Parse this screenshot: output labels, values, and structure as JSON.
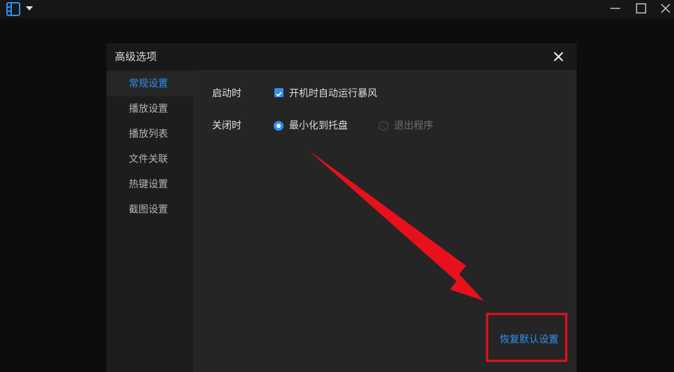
{
  "window": {
    "icon": "film-grid-icon",
    "menu_icon": "caret-down-icon",
    "controls": [
      "minimize-icon",
      "maximize-icon",
      "close-icon"
    ]
  },
  "dialog": {
    "title": "高级选项",
    "close_icon": "close-icon"
  },
  "sidebar": {
    "items": [
      {
        "label": "常规设置",
        "active": true
      },
      {
        "label": "播放设置",
        "active": false
      },
      {
        "label": "播放列表",
        "active": false
      },
      {
        "label": "文件关联",
        "active": false
      },
      {
        "label": "热键设置",
        "active": false
      },
      {
        "label": "截图设置",
        "active": false
      }
    ]
  },
  "general": {
    "startup": {
      "label": "启动时",
      "checkbox_label": "开机时自动运行暴风",
      "checked": true
    },
    "on_close": {
      "label": "关闭时",
      "options": [
        {
          "label": "最小化到托盘",
          "selected": true
        },
        {
          "label": "退出程序",
          "selected": false
        }
      ]
    }
  },
  "footer": {
    "restore_defaults": "恢复默认设置"
  },
  "annotation": {
    "arrow_color": "#e8101c",
    "box_color": "#e8101c"
  },
  "colors": {
    "accent": "#2f8ff0"
  }
}
